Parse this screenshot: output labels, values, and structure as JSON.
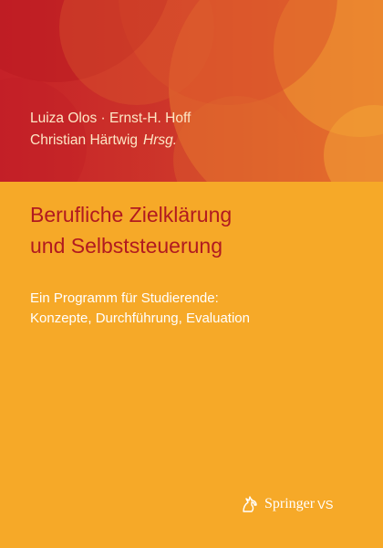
{
  "authors": {
    "line1": "Luiza Olos · Ernst-H. Hoff",
    "line2": "Christian Härtwig",
    "role": "Hrsg."
  },
  "book": {
    "title_line1": "Berufliche Zielklärung",
    "title_line2": "und Selbststeuerung",
    "subtitle_line1": "Ein Programm für Studierende:",
    "subtitle_line2": "Konzepte, Durchführung, Evaluation"
  },
  "publisher": {
    "name": "Springer",
    "imprint": "VS",
    "logo_icon": "springer-horse-icon"
  },
  "colors": {
    "background": "#f6a928",
    "band_red": "#c8262b",
    "title": "#b11a20",
    "text_light": "#ffffff"
  }
}
